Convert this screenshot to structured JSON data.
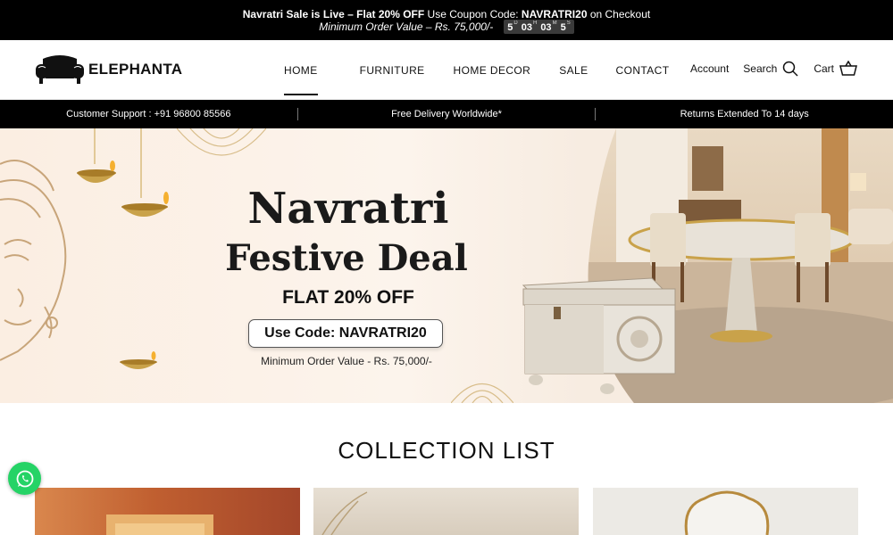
{
  "announcement": {
    "bold1": "Navratri Sale is Live – Flat 20% OFF",
    "text1": " Use Coupon Code: ",
    "code": "NAVRATRI20",
    "text2": " on Checkout",
    "min_order": "Minimum Order Value – Rs. 75,000/-",
    "timer": [
      {
        "value": "5",
        "unit": "D"
      },
      {
        "value": "03",
        "unit": "H"
      },
      {
        "value": "03",
        "unit": "M"
      },
      {
        "value": "5",
        "unit": "S"
      }
    ]
  },
  "header": {
    "logo_text": "ELEPHANTA",
    "nav": [
      "HOME",
      "FURNITURE",
      "HOME DECOR",
      "SALE",
      "CONTACT"
    ],
    "account": "Account",
    "search": "Search",
    "cart": "Cart"
  },
  "infobar": {
    "support": "Customer Support : +91 96800 85566",
    "delivery": "Free Delivery Worldwide*",
    "returns": "Returns Extended To 14 days"
  },
  "hero": {
    "title_line1": "Navratri",
    "title_line2": "Festive Deal",
    "offer": "FLAT 20% OFF",
    "code_label": "Use Code: NAVRATRI20",
    "min_order": "Minimum Order Value - Rs. 75,000/-"
  },
  "collection": {
    "title": "COLLECTION LIST"
  },
  "colors": {
    "bar_bg": "#000000",
    "hero_bg": "#fcf3ea",
    "whatsapp": "#25D366",
    "gold": "#c9a24a"
  }
}
